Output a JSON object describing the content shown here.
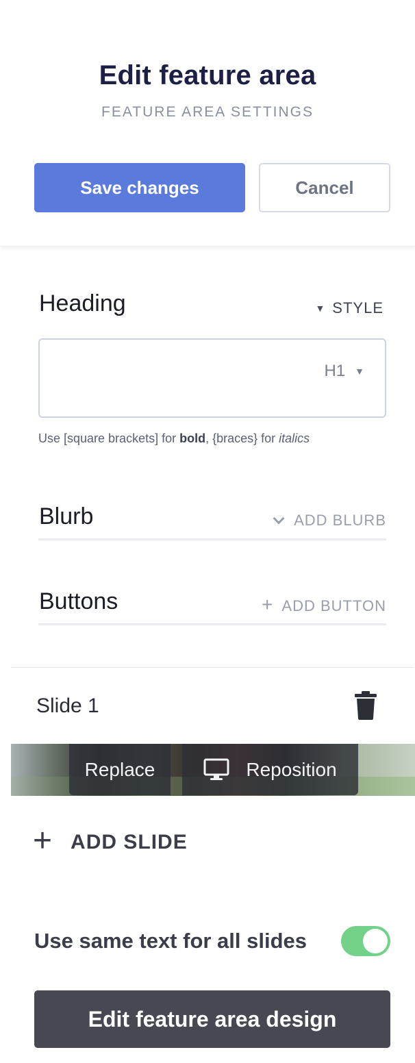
{
  "header": {
    "title": "Edit feature area",
    "subtitle": "FEATURE AREA SETTINGS",
    "save_label": "Save changes",
    "cancel_label": "Cancel"
  },
  "heading_section": {
    "label": "Heading",
    "style_label": "STYLE",
    "input_value": "",
    "level_select": "H1",
    "hint": {
      "prefix": "Use [square brackets] for ",
      "bold": "bold",
      "middle": ", {braces} for ",
      "italic": "italics"
    }
  },
  "blurb_section": {
    "label": "Blurb",
    "action_label": "ADD BLURB"
  },
  "buttons_section": {
    "label": "Buttons",
    "action_label": "ADD BUTTON"
  },
  "slides": [
    {
      "label": "Slide 1",
      "replace_label": "Replace",
      "reposition_label": "Reposition"
    }
  ],
  "add_slide_label": "ADD SLIDE",
  "same_text_toggle": {
    "label": "Use same text for all slides",
    "enabled": true
  },
  "edit_design_label": "Edit feature area design",
  "colors": {
    "accent": "#5b7bdc",
    "toggle_on": "#74d18a",
    "dark_button": "#474851",
    "title": "#1d2044"
  },
  "icons": [
    "triangle-down-icon",
    "chevron-down-icon",
    "plus-icon",
    "trash-icon",
    "monitor-icon"
  ]
}
